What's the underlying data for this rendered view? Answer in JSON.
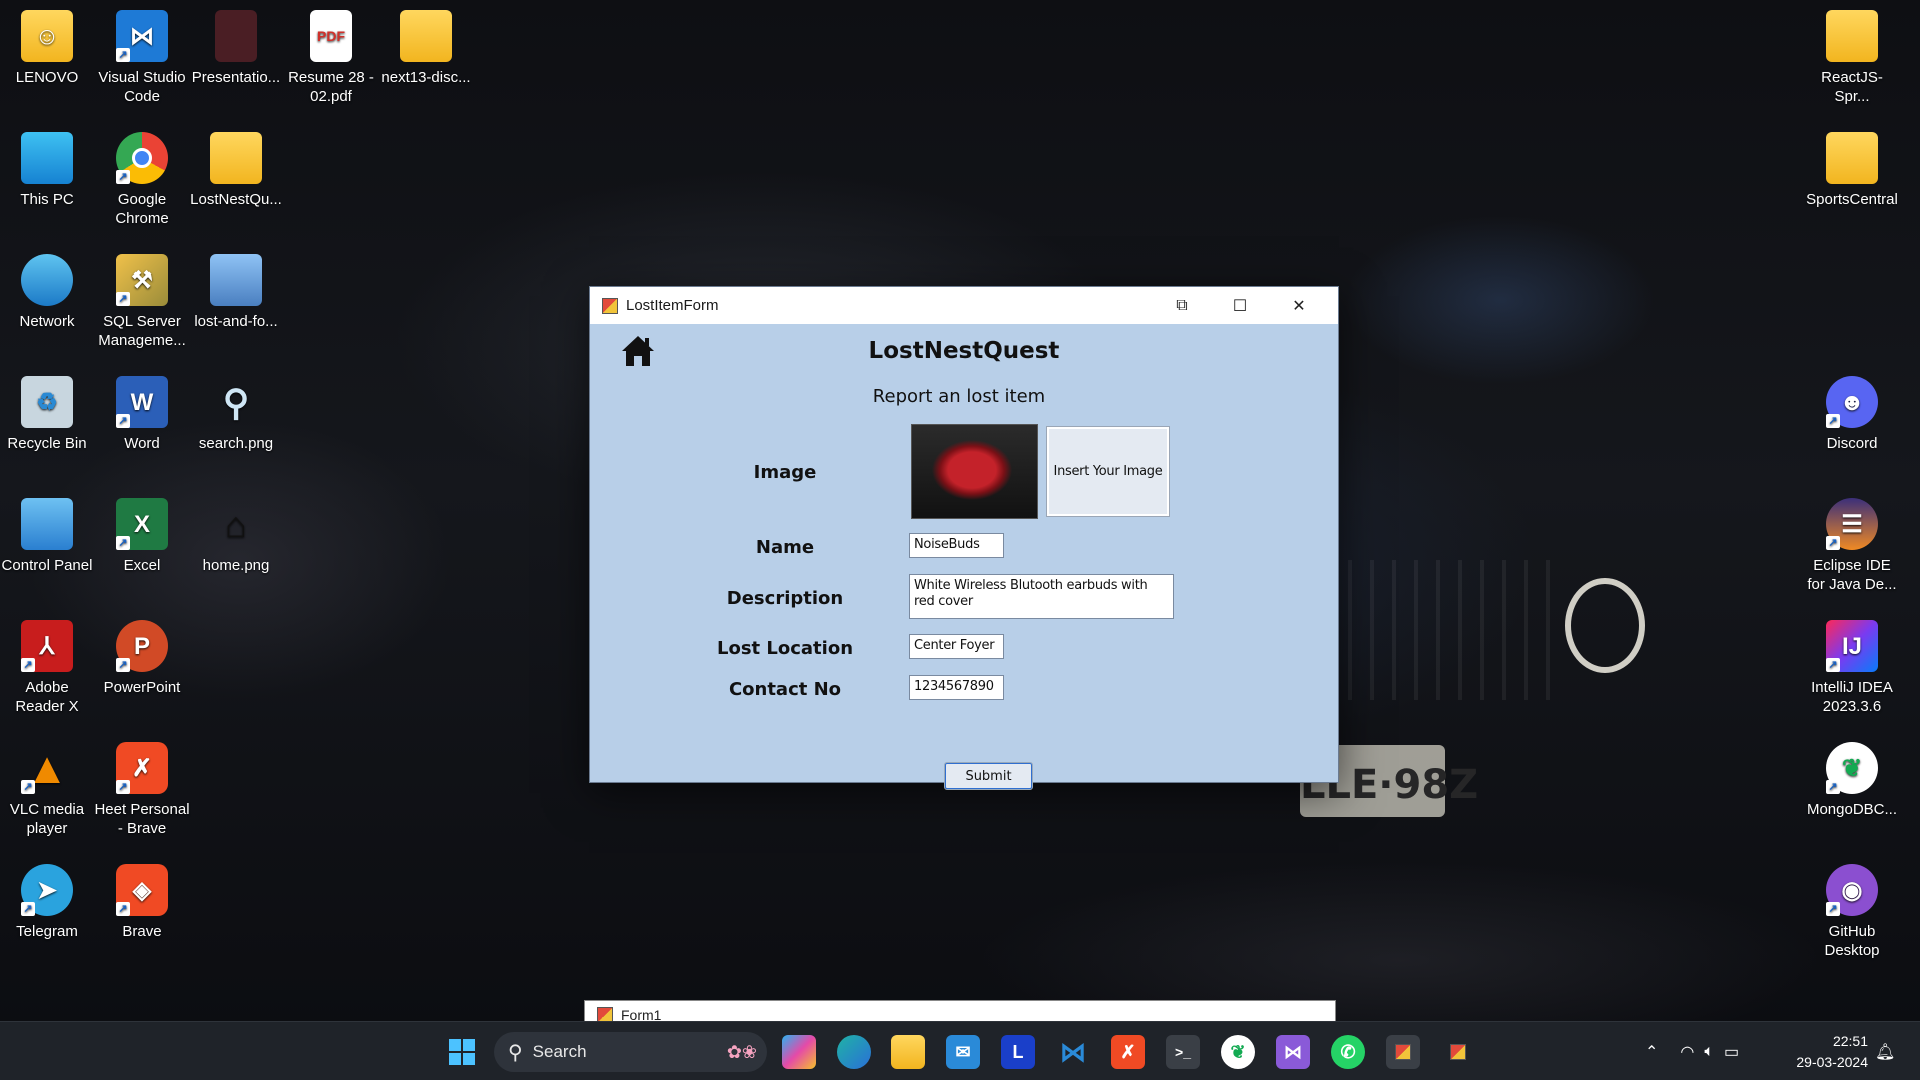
{
  "desktop": {
    "icons_left": [
      {
        "label": "LENOVO",
        "icon": "user-folder-icon"
      },
      {
        "label": "Visual Studio Code",
        "icon": "vscode-icon"
      },
      {
        "label": "Presentatio...",
        "icon": "presentation-file-icon"
      },
      {
        "label": "Resume 28 - 02.pdf",
        "icon": "pdf-icon"
      },
      {
        "label": "next13-disc...",
        "icon": "folder-icon"
      },
      {
        "label": "This PC",
        "icon": "monitor-icon"
      },
      {
        "label": "Google Chrome",
        "icon": "chrome-icon"
      },
      {
        "label": "LostNestQu...",
        "icon": "folder-icon"
      },
      {
        "label": "Network",
        "icon": "network-icon"
      },
      {
        "label": "SQL Server Manageme...",
        "icon": "sql-server-icon"
      },
      {
        "label": "lost-and-fo...",
        "icon": "image-file-icon"
      },
      {
        "label": "Recycle Bin",
        "icon": "recycle-bin-icon"
      },
      {
        "label": "Word",
        "icon": "word-icon"
      },
      {
        "label": "search.png",
        "icon": "magnifier-image-icon"
      },
      {
        "label": "Control Panel",
        "icon": "control-panel-icon"
      },
      {
        "label": "Excel",
        "icon": "excel-icon"
      },
      {
        "label": "home.png",
        "icon": "home-image-icon"
      },
      {
        "label": "Adobe Reader X",
        "icon": "adobe-reader-icon"
      },
      {
        "label": "PowerPoint",
        "icon": "powerpoint-icon"
      },
      {
        "label": "VLC media player",
        "icon": "vlc-icon"
      },
      {
        "label": "Heet Personal - Brave",
        "icon": "brave-profile-icon"
      },
      {
        "label": "Telegram",
        "icon": "telegram-icon"
      },
      {
        "label": "Brave",
        "icon": "brave-icon"
      }
    ],
    "icons_right": [
      {
        "label": "ReactJS-Spr...",
        "icon": "folder-icon"
      },
      {
        "label": "SportsCentral",
        "icon": "folder-icon"
      },
      {
        "label": "Discord",
        "icon": "discord-icon"
      },
      {
        "label": "Eclipse IDE for Java De...",
        "icon": "eclipse-icon"
      },
      {
        "label": "IntelliJ IDEA 2023.3.6",
        "icon": "intellij-icon"
      },
      {
        "label": "MongoDBC...",
        "icon": "mongodb-icon"
      },
      {
        "label": "GitHub Desktop",
        "icon": "github-desktop-icon"
      }
    ],
    "wallpaper_plate_text": "LLE·98Z"
  },
  "window": {
    "title": "LostItemForm",
    "restore_glyph": "⧉",
    "maximize_glyph": "☐",
    "close_glyph": "✕"
  },
  "form": {
    "heading": "LostNestQuest",
    "subheading": "Report an lost item",
    "image_label": "Image",
    "insert_image_button": "Insert Your Image",
    "name_label": "Name",
    "name_value": "NoiseBuds",
    "description_label": "Description",
    "description_value": "White Wireless Blutooth earbuds with red cover",
    "location_label": "Lost Location",
    "location_value": "Center Foyer",
    "contact_label": "Contact No",
    "contact_value": "1234567890",
    "submit_button": "Submit"
  },
  "second_window": {
    "title": "Form1"
  },
  "taskbar": {
    "search_label": "Search",
    "pinned": [
      "windows-start-icon",
      "copilot-icon",
      "edge-icon",
      "file-explorer-icon",
      "mail-icon",
      "l-app-icon",
      "vscode-icon",
      "brave-icon",
      "terminal-icon",
      "mongodb-icon",
      "visual-studio-icon",
      "whatsapp-icon",
      "winforms-app-icon",
      "winforms-app-icon"
    ],
    "time": "22:51",
    "date": "29-03-2024"
  },
  "colors": {
    "window_bg": "#b8cfe8",
    "titlebar_bg": "#ffffff",
    "taskbar_bg": "#1f2329"
  }
}
